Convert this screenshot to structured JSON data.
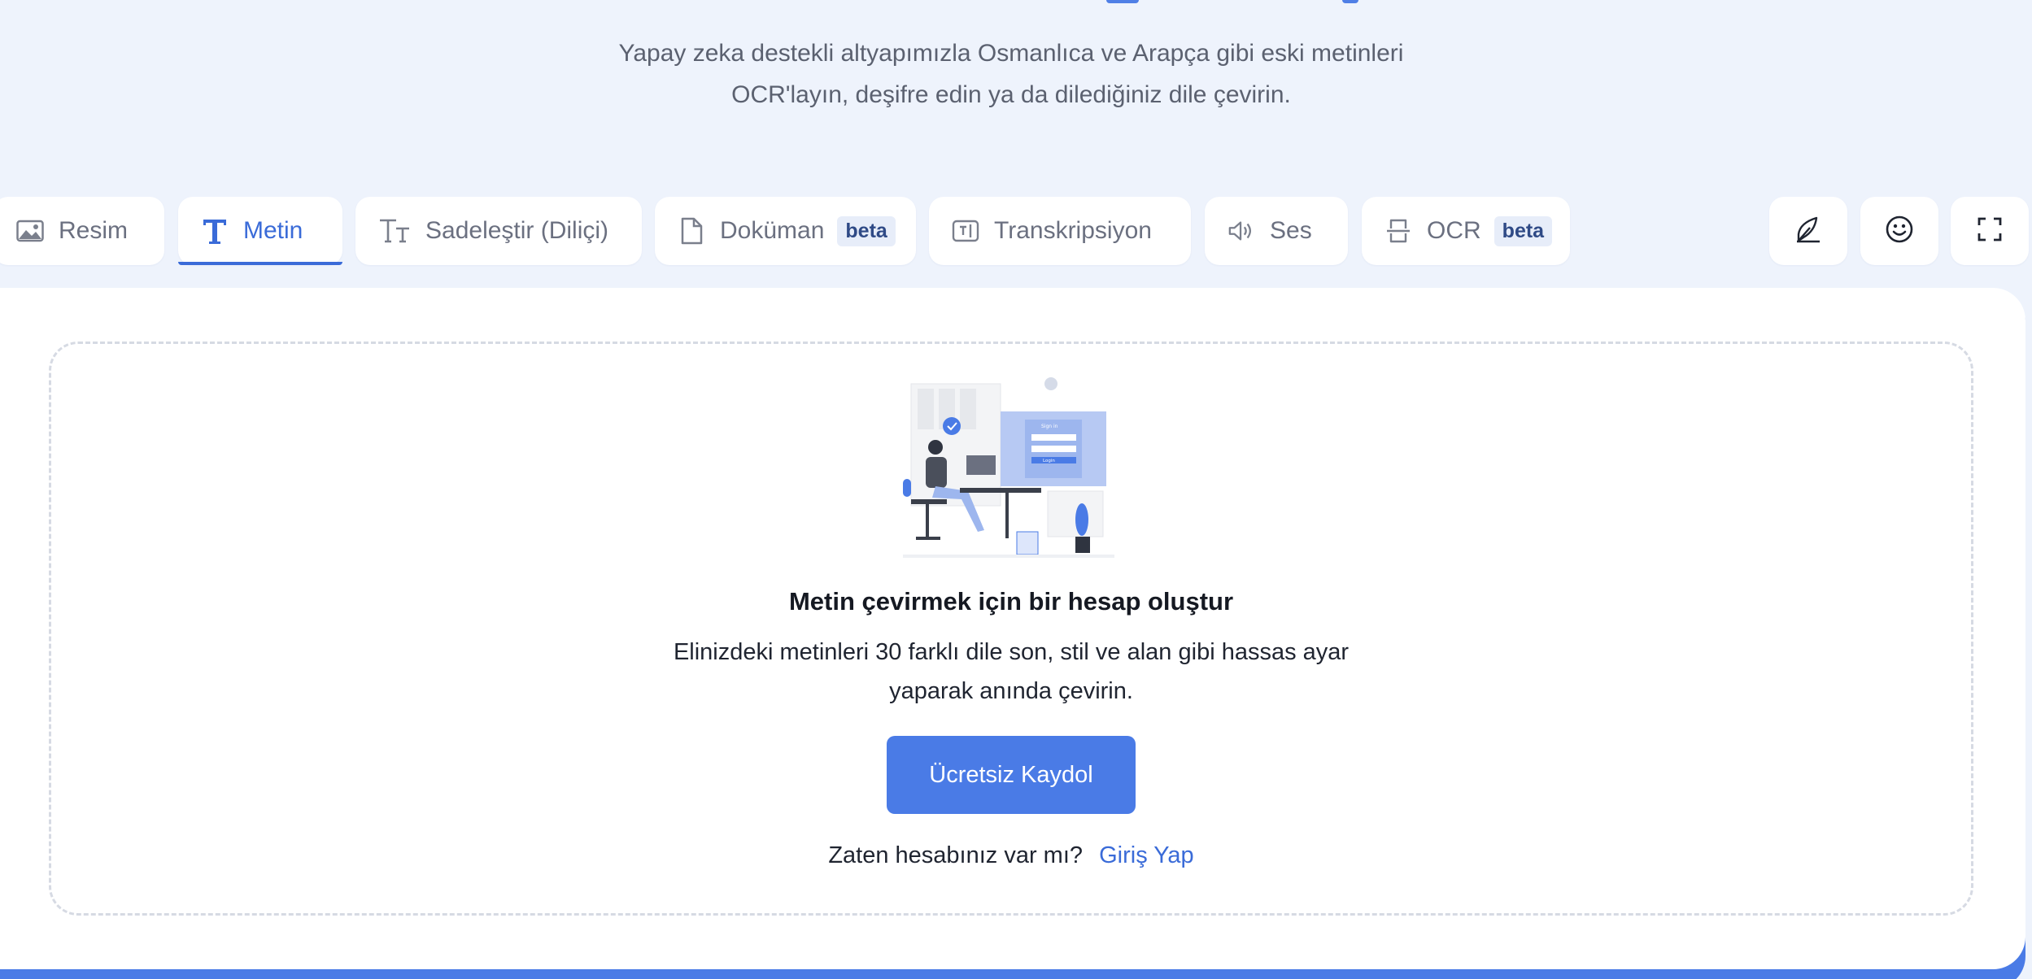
{
  "intro": {
    "line1": "Yapay zeka destekli altyapımızla Osmanlıca ve Arapça gibi eski metinleri",
    "line2": "OCR'layın, deşifre edin ya da dilediğiniz dile çevirin."
  },
  "tabs": [
    {
      "label": "Resim",
      "icon": "image-icon",
      "active": false
    },
    {
      "label": "Metin",
      "icon": "text-icon",
      "active": true
    },
    {
      "label": "Sadeleştir (Diliçi)",
      "icon": "text-size-icon",
      "active": false
    },
    {
      "label": "Doküman",
      "icon": "document-icon",
      "badge": "beta",
      "active": false
    },
    {
      "label": "Transkripsiyon",
      "icon": "transcription-icon",
      "active": false
    },
    {
      "label": "Ses",
      "icon": "speaker-icon",
      "active": false
    },
    {
      "label": "OCR",
      "icon": "scan-icon",
      "badge": "beta",
      "active": false
    }
  ],
  "tools": [
    {
      "icon": "feather-pen-icon"
    },
    {
      "icon": "smiley-icon"
    },
    {
      "icon": "fullscreen-icon"
    }
  ],
  "cta": {
    "title": "Metin çevirmek için bir hesap oluştur",
    "desc_line1": "Elinizdeki metinleri 30 farklı dile son, stil ve alan gibi hassas ayar",
    "desc_line2": "yaparak anında çevirin.",
    "signup_label": "Ücretsiz Kaydol",
    "have_account": "Zaten hesabınız var mı?",
    "login_label": "Giriş Yap",
    "illustration_caption": "Login"
  },
  "colors": {
    "accent": "#4a7be6",
    "active_tab": "#3a6bd8",
    "background": "#eef3fc",
    "badge_bg": "#e7edf9"
  }
}
